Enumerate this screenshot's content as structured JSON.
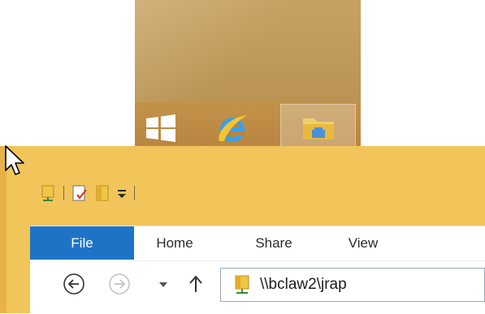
{
  "taskbar": {
    "items": [
      {
        "name": "Start",
        "icon": "windows-logo-icon"
      },
      {
        "name": "Internet Explorer",
        "icon": "internet-explorer-icon"
      },
      {
        "name": "File Explorer",
        "icon": "file-explorer-icon",
        "active": true
      }
    ]
  },
  "explorer": {
    "quick_access_toolbar": {
      "icons": [
        "network-folder-icon",
        "properties-icon",
        "new-folder-icon",
        "customize-toolbar-icon"
      ]
    },
    "ribbon": {
      "tabs": [
        {
          "label": "File",
          "selected": true
        },
        {
          "label": "Home"
        },
        {
          "label": "Share"
        },
        {
          "label": "View"
        }
      ]
    },
    "navigation": {
      "address": "\\\\bclaw2\\jrap"
    }
  },
  "colors": {
    "window_frame": "#f2c55b",
    "file_tab": "#1e73c7",
    "desktop": "#c6a15f"
  }
}
